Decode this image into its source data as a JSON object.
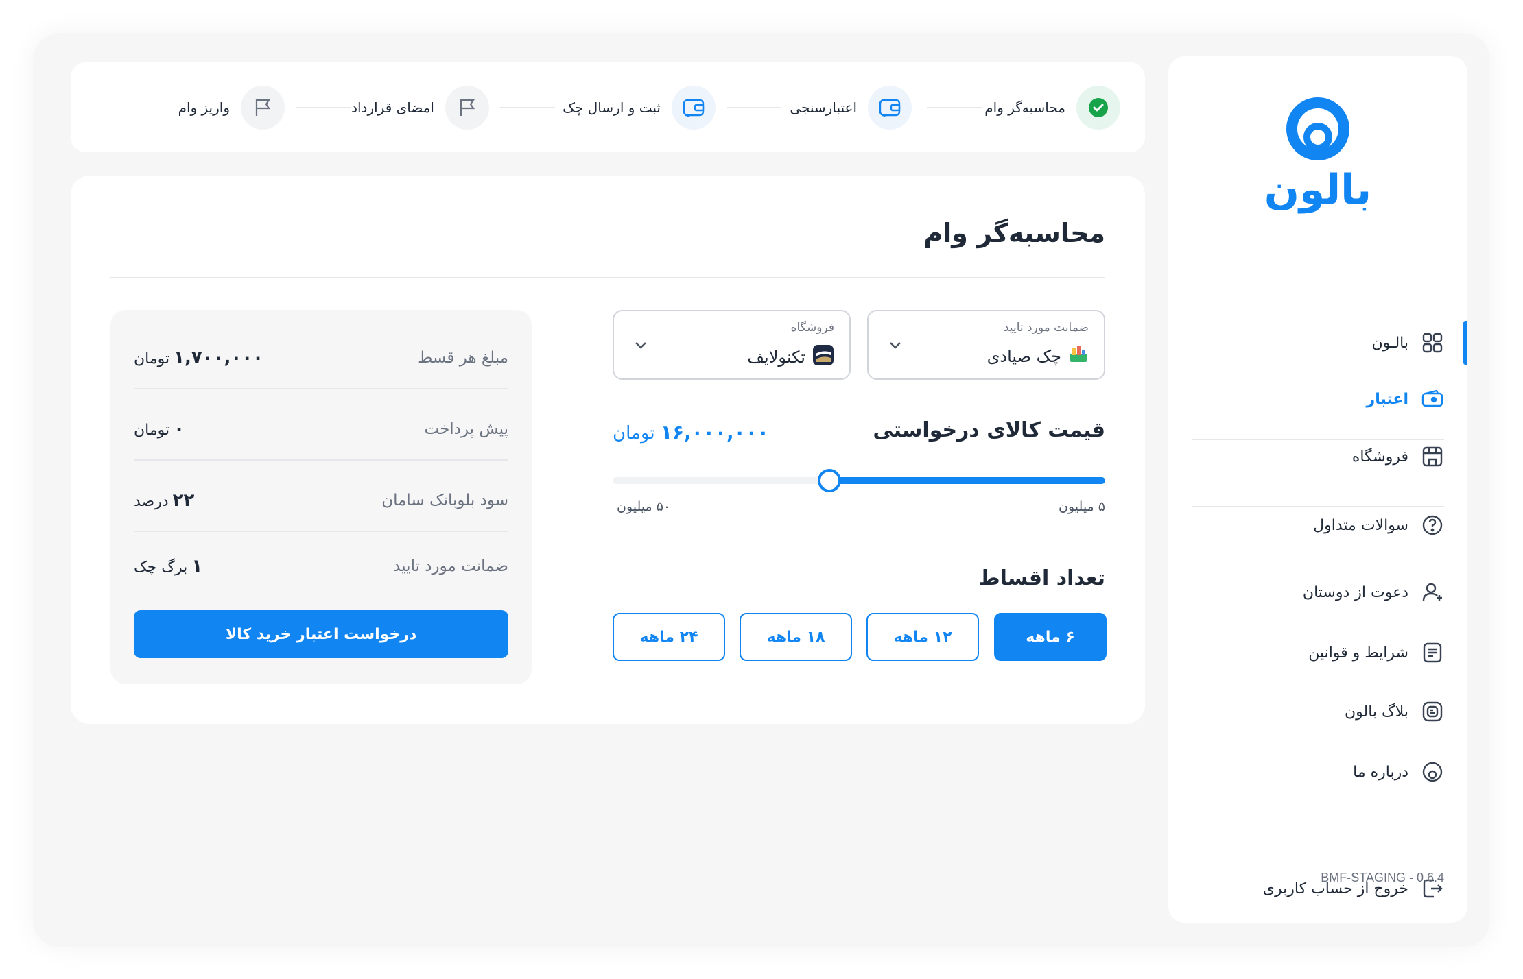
{
  "brand": {
    "name": "بالون",
    "color": "#1185f2"
  },
  "sidebar": {
    "items": [
      {
        "label": "بالـون",
        "icon": "grid-icon"
      },
      {
        "label": "اعتبار",
        "icon": "wallet-icon",
        "active": true
      },
      {
        "label": "فروشگاه",
        "icon": "store-icon"
      },
      {
        "label": "سوالات متداول",
        "icon": "question-icon"
      },
      {
        "label": "دعوت از دوستان",
        "icon": "user-plus-icon"
      },
      {
        "label": "شرایط و قوانین",
        "icon": "document-icon"
      },
      {
        "label": "بلاگ بالون",
        "icon": "blog-icon"
      },
      {
        "label": "درباره ما",
        "icon": "balloon-icon"
      }
    ],
    "logout": {
      "label": "خروج از حساب کاربری",
      "icon": "logout-icon"
    },
    "version": "BMF-STAGING - 0.6.4"
  },
  "stepper": {
    "steps": [
      {
        "label": "محاسبه‌گر وام",
        "status": "done",
        "icon": "check-icon"
      },
      {
        "label": "اعتبارسنجی",
        "status": "pending",
        "icon": "wallet-icon"
      },
      {
        "label": "ثبت و ارسال چک",
        "status": "pending",
        "icon": "wallet-icon"
      },
      {
        "label": "امضای قرارداد",
        "status": "idle",
        "icon": "flag-icon"
      },
      {
        "label": "واریز وام",
        "status": "idle",
        "icon": "flag-icon"
      }
    ]
  },
  "main": {
    "title": "محاسبه‌گر وام",
    "guarantee_select": {
      "caption": "ضمانت مورد تایید",
      "value": "چک صیادی",
      "icon": "check-leaf-icon"
    },
    "store_select": {
      "caption": "فروشگاه",
      "value": "تکنولایف",
      "icon": "store-logo-icon"
    },
    "price": {
      "label": "قیمت کالای درخواستی",
      "value": "۱۶,۰۰۰,۰۰۰",
      "unit": "تومان",
      "slider_min": "۵ میلیون",
      "slider_max": "۵۰ میلیون",
      "slider_fraction": 0.56
    },
    "installments": {
      "label": "تعداد اقساط",
      "options": [
        "۶ ماهه",
        "۱۲ ماهه",
        "۱۸ ماهه",
        "۲۴ ماهه"
      ],
      "selected": "۶ ماهه"
    }
  },
  "summary": {
    "rows": [
      {
        "label": "مبلغ هر قسط",
        "value": "۱,۷۰۰,۰۰۰",
        "unit": "تومان"
      },
      {
        "label": "پیش پرداخت",
        "value": "۰",
        "unit": "تومان"
      },
      {
        "label": "سود بلوبانک سامان",
        "value": "۲۲",
        "unit": "درصد"
      },
      {
        "label": "ضمانت مورد تایید",
        "value": "۱",
        "unit": "برگ چک"
      }
    ],
    "button": "درخواست اعتبار خرید کالا"
  }
}
